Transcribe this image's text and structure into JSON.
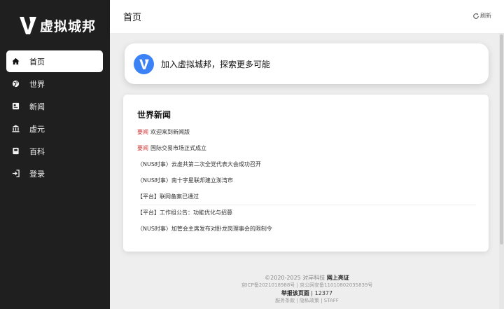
{
  "brand": {
    "name": "虚拟城邦"
  },
  "sidebar": {
    "items": [
      {
        "label": "首页",
        "icon": "home-icon",
        "active": true
      },
      {
        "label": "世界",
        "icon": "globe-icon",
        "active": false
      },
      {
        "label": "新闻",
        "icon": "newspaper-icon",
        "active": false
      },
      {
        "label": "虚元",
        "icon": "bank-icon",
        "active": false
      },
      {
        "label": "百科",
        "icon": "book-icon",
        "active": false
      },
      {
        "label": "登录",
        "icon": "login-icon",
        "active": false
      }
    ]
  },
  "header": {
    "title": "首页",
    "refresh_label": "刷新"
  },
  "join": {
    "text": "加入虚拟城邦，探索更多可能"
  },
  "news": {
    "title": "世界新闻",
    "items": [
      {
        "tag": "要闻",
        "text": "欢迎来到新闻版"
      },
      {
        "tag": "要闻",
        "text": "国际交易市场正式成立"
      },
      {
        "tag": "",
        "text": "〈NUS时事〉云虚共第二次全党代表大会成功召开"
      },
      {
        "tag": "",
        "text": "〈NUS时事〉南十字星联邦建立澎湾市"
      },
      {
        "tag": "",
        "text": "【平台】联网备案已通过"
      },
      {
        "tag": "",
        "text": "【平台】工作组公告：功能优化与招募"
      },
      {
        "tag": "",
        "text": "〈NUS时事〉加管会主席发布对卧龙岗理事会的限制令"
      }
    ]
  },
  "footer": {
    "copyright": "©2020-2025 对岸科技",
    "certified": "网上亮证",
    "icp": "京ICP备2021018988号 | 京公网安备11010802035839号",
    "report_label": "举报该页面",
    "report_count": "| 12377",
    "links": "服务条款 | 隐私政策 | STAFF"
  },
  "colors": {
    "sidebar": "#1f1f1f",
    "accent": "#3b82f6",
    "tag": "#d23b3b"
  }
}
